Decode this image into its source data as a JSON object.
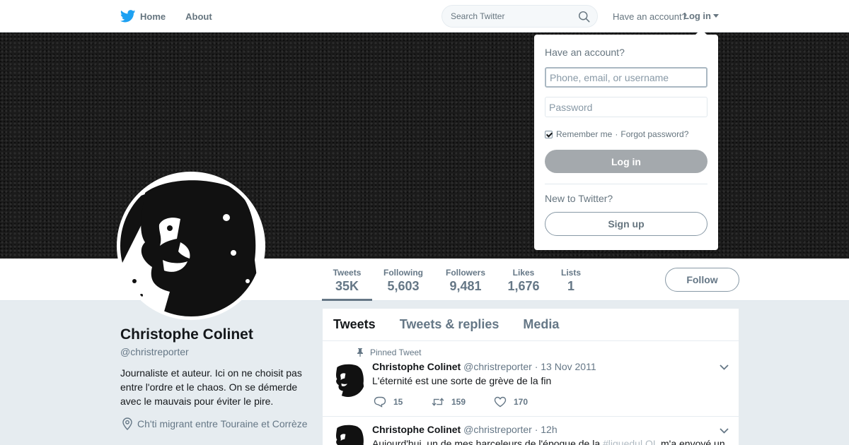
{
  "nav": {
    "home_label": "Home",
    "about_label": "About",
    "search_placeholder": "Search Twitter",
    "have_account": "Have an account?",
    "login_label": "Log in",
    "brand_color": "#1da1f2",
    "icons": [
      "twitter-bird-icon",
      "search-icon",
      "caret-down-icon"
    ]
  },
  "profile": {
    "name": "Christophe Colinet",
    "handle": "@christreporter",
    "bio": "Journaliste et auteur. Ici on ne choisit pas entre l'ordre et le chaos. On se démerde avec le mauvais pour éviter le pire.",
    "location": "Ch'ti migrant entre Touraine et Corrèze"
  },
  "stats": [
    {
      "label": "Tweets",
      "value": "35K",
      "active": true
    },
    {
      "label": "Following",
      "value": "5,603"
    },
    {
      "label": "Followers",
      "value": "9,481"
    },
    {
      "label": "Likes",
      "value": "1,676"
    },
    {
      "label": "Lists",
      "value": "1"
    }
  ],
  "follow_label": "Follow",
  "timeline": {
    "tabs": [
      "Tweets",
      "Tweets & replies",
      "Media"
    ],
    "active_tab": "Tweets",
    "tweets": [
      {
        "pinned_label": "Pinned Tweet",
        "name": "Christophe Colinet",
        "handle": "@christreporter",
        "time": "· 13 Nov 2011",
        "text": "L'éternité est une sorte de grève de la fin",
        "replies": "15",
        "retweets": "159",
        "likes": "170"
      },
      {
        "name": "Christophe Colinet",
        "handle": "@christreporter",
        "time": "· 12h",
        "text_before": "Aujourd'hui, un de mes harceleurs de l'époque de la ",
        "hashtag": "#liguedul OL",
        "text_after": " m'a envoyé un"
      }
    ]
  },
  "login_dropdown": {
    "title": "Have an account?",
    "username_placeholder": "Phone, email, or username",
    "password_placeholder": "Password",
    "remember_label": "Remember me",
    "remember_checked": true,
    "forgot_label": "Forgot password?",
    "login_button": "Log in",
    "new_label": "New to Twitter?",
    "signup_button": "Sign up"
  }
}
